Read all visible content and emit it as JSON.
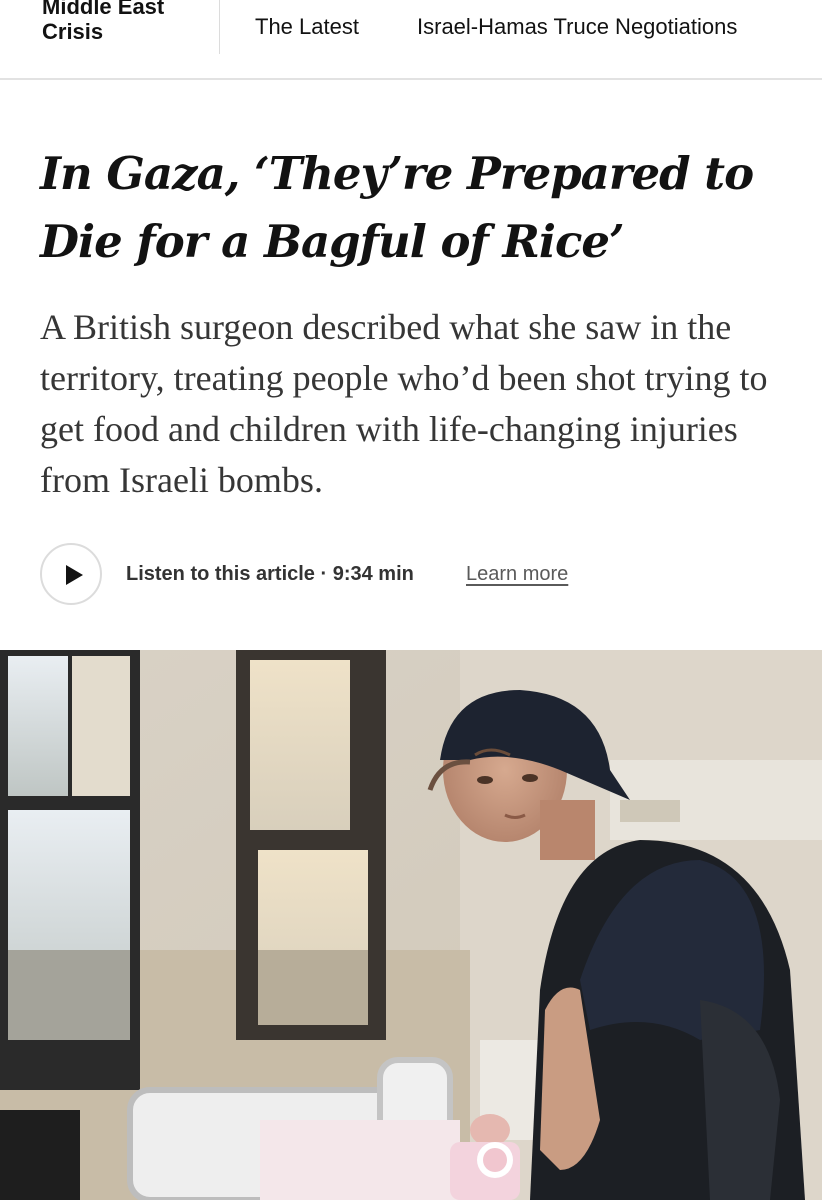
{
  "nav": {
    "section_title": "Middle East Crisis",
    "links": [
      "The Latest",
      "Israel-Hamas Truce Negotiations"
    ]
  },
  "article": {
    "headline": "In Gaza, ‘They’re Prepared to Die for a Bagful of Rice’",
    "summary": "A British surgeon described what she saw in the territory, treating people who’d been shot trying to get food and children with life-changing injuries from Israeli bombs."
  },
  "audio": {
    "play_icon": "play-icon",
    "listen_label": "Listen to this article · 9:34 min",
    "learn_more": "Learn more"
  },
  "colors": {
    "text": "#121212",
    "summary_text": "#363636",
    "divider": "#e2e2e2"
  }
}
